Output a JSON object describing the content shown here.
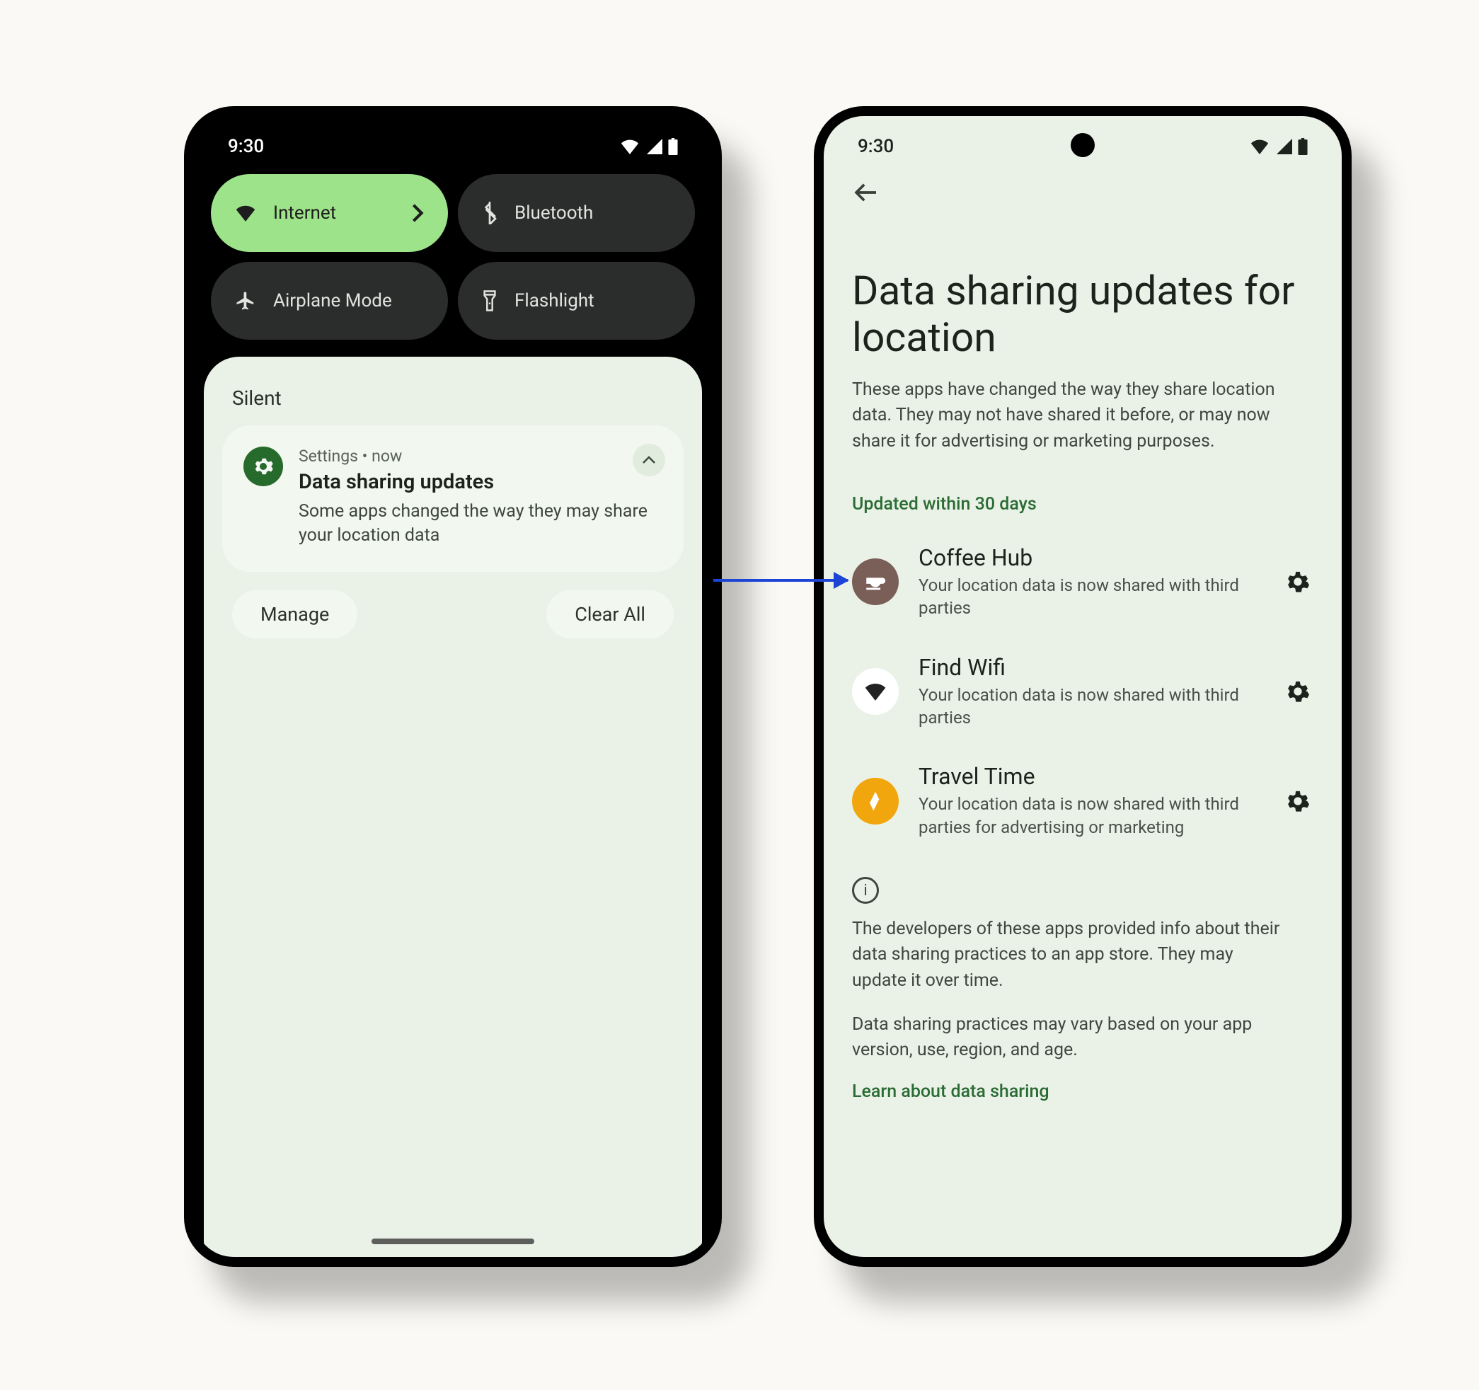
{
  "status": {
    "time": "9:30"
  },
  "qs": {
    "internet": "Internet",
    "bluetooth": "Bluetooth",
    "airplane": "Airplane Mode",
    "flashlight": "Flashlight"
  },
  "shade": {
    "silent_label": "Silent",
    "notif": {
      "app_line": "Settings  •  now",
      "title": "Data sharing updates",
      "body": "Some apps changed the way they may share your location data"
    },
    "manage": "Manage",
    "clear_all": "Clear All"
  },
  "page": {
    "title": "Data sharing updates for location",
    "subtitle": "These apps have changed the way they share location data. They may not have shared it before, or may now share it for advertising or marketing purposes.",
    "section_label": "Updated within 30 days",
    "apps": [
      {
        "name": "Coffee Hub",
        "desc": "Your location data is now shared with third parties",
        "icon_bg": "#7a5f59",
        "icon_fg": "#fff"
      },
      {
        "name": "Find Wifi",
        "desc": "Your location data is now shared with third parties",
        "icon_bg": "#ffffff",
        "icon_fg": "#222"
      },
      {
        "name": "Travel Time",
        "desc": "Your location data is now shared with third parties for advertising or marketing",
        "icon_bg": "#f2a60d",
        "icon_fg": "#fff"
      }
    ],
    "info1": "The developers of these apps provided info about their data sharing practices to an app store. They may update it over time.",
    "info2": "Data sharing practices may vary based on your app version, use, region, and age.",
    "learn": "Learn about data sharing"
  }
}
